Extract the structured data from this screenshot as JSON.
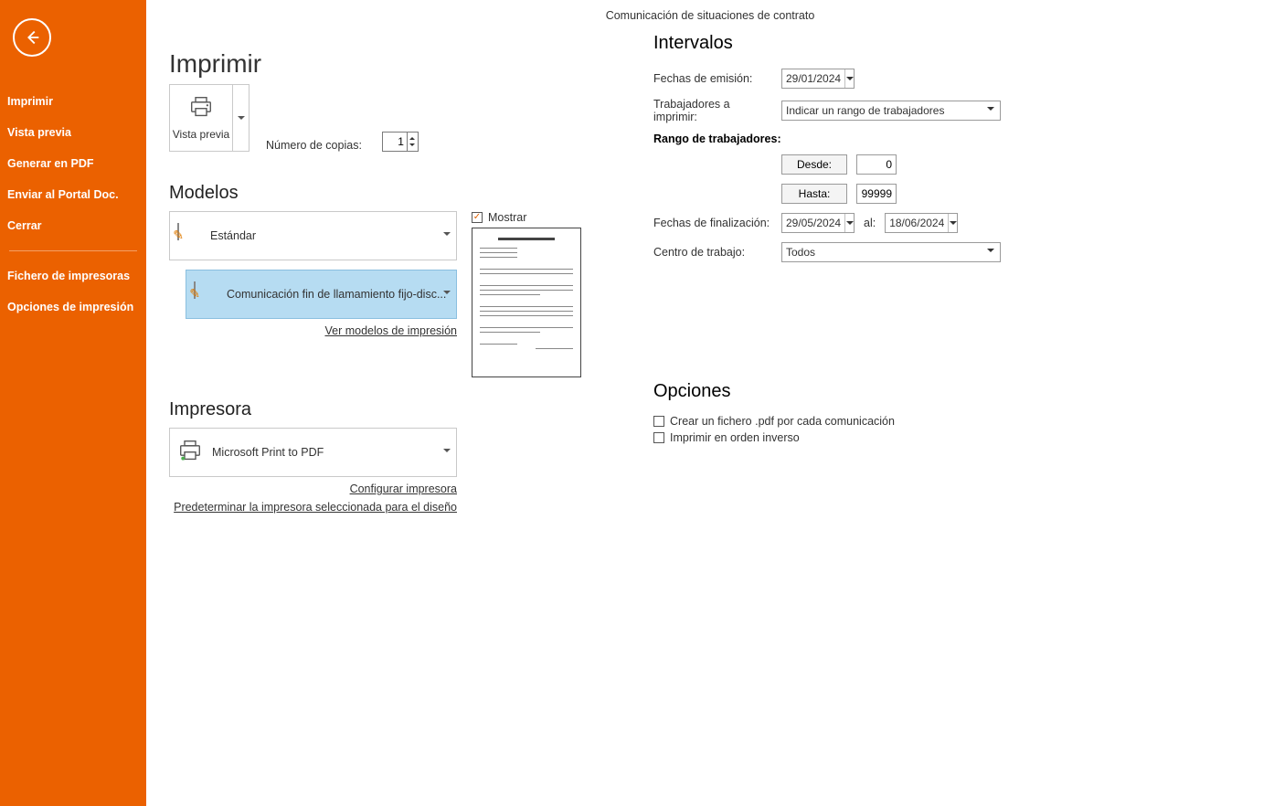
{
  "app_title": "Comunicación de situaciones de contrato",
  "page_title": "Imprimir",
  "sidebar": {
    "items": [
      "Imprimir",
      "Vista previa",
      "Generar en PDF",
      "Enviar al Portal Doc.",
      "Cerrar",
      "Fichero de impresoras",
      "Opciones de impresión"
    ]
  },
  "preview_button": {
    "label": "Vista previa"
  },
  "copies": {
    "label": "Número de copias:",
    "value": "1"
  },
  "sections": {
    "modelos": "Modelos",
    "impresora": "Impresora",
    "intervalos": "Intervalos",
    "opciones": "Opciones"
  },
  "modelos": {
    "estandar": "Estándar",
    "selected": "Comunicación fin de llamamiento fijo-disc...",
    "show_chk": "Mostrar",
    "link_ver": "Ver modelos de impresión"
  },
  "impresora": {
    "name": "Microsoft Print to PDF",
    "link_config": "Configurar impresora",
    "link_predet": "Predeterminar la impresora seleccionada para el diseño"
  },
  "intervalos": {
    "fechas_emision_lbl": "Fechas de emisión:",
    "fechas_emision_val": "29/01/2024",
    "trab_imprimir_lbl": "Trabajadores a imprimir:",
    "trab_imprimir_val": "Indicar un rango de trabajadores",
    "rango_lbl": "Rango de trabajadores:",
    "desde_btn": "Desde:",
    "desde_val": "0",
    "hasta_btn": "Hasta:",
    "hasta_val": "99999",
    "fin_lbl": "Fechas de finalización:",
    "fin_from": "29/05/2024",
    "al_lbl": "al:",
    "fin_to": "18/06/2024",
    "centro_lbl": "Centro de trabajo:",
    "centro_val": "Todos"
  },
  "opciones": {
    "pdf_each": "Crear un fichero .pdf por cada comunicación",
    "reverse": "Imprimir en orden inverso"
  }
}
